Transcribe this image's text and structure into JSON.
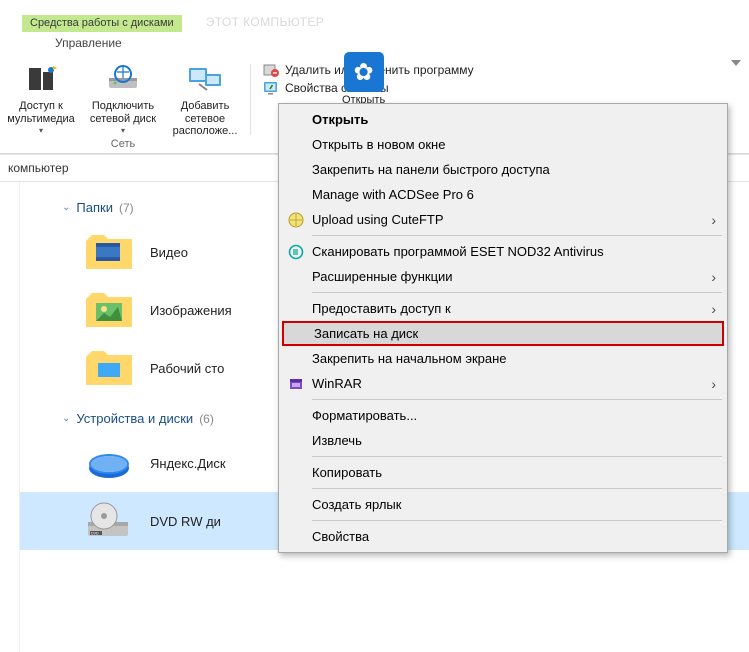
{
  "titlebar": {
    "context_tab": "Средства работы с дисками",
    "window_title": "ЭТОТ КОМПЬЮТЕР",
    "subtab": "Управление"
  },
  "ribbon": {
    "btn_media": "Доступ к\nмультимедиа",
    "btn_netdrive": "Подключить\nсетевой диск",
    "btn_addloc": "Добавить сетевое\nрасположе...",
    "group_network": "Сеть",
    "btn_open": "Открыть",
    "right_remove": "Удалить или изменить программу",
    "right_props": "Свойства системы"
  },
  "breadcrumb": {
    "path": "компьютер"
  },
  "groups": {
    "folders_label": "Папки",
    "folders_count": "(7)",
    "devices_label": "Устройства и диски",
    "devices_count": "(6)"
  },
  "items": {
    "video": "Видео",
    "images": "Изображения",
    "desktop": "Рабочий сто",
    "yadisk": "Яндекс.Диск",
    "dvdrw": "DVD RW ди"
  },
  "menu": {
    "open": "Открыть",
    "open_new": "Открыть в новом окне",
    "pin_quick": "Закрепить на панели быстрого доступа",
    "acdsee": "Manage with ACDSee Pro 6",
    "cuteftp": "Upload using CuteFTP",
    "eset": "Сканировать программой ESET NOD32 Antivirus",
    "ext": "Расширенные функции",
    "share": "Предоставить доступ к",
    "burn": "Записать на диск",
    "pin_start": "Закрепить на начальном экране",
    "winrar": "WinRAR",
    "format": "Форматировать...",
    "eject": "Извлечь",
    "copy": "Копировать",
    "shortcut": "Создать ярлык",
    "props": "Свойства"
  }
}
